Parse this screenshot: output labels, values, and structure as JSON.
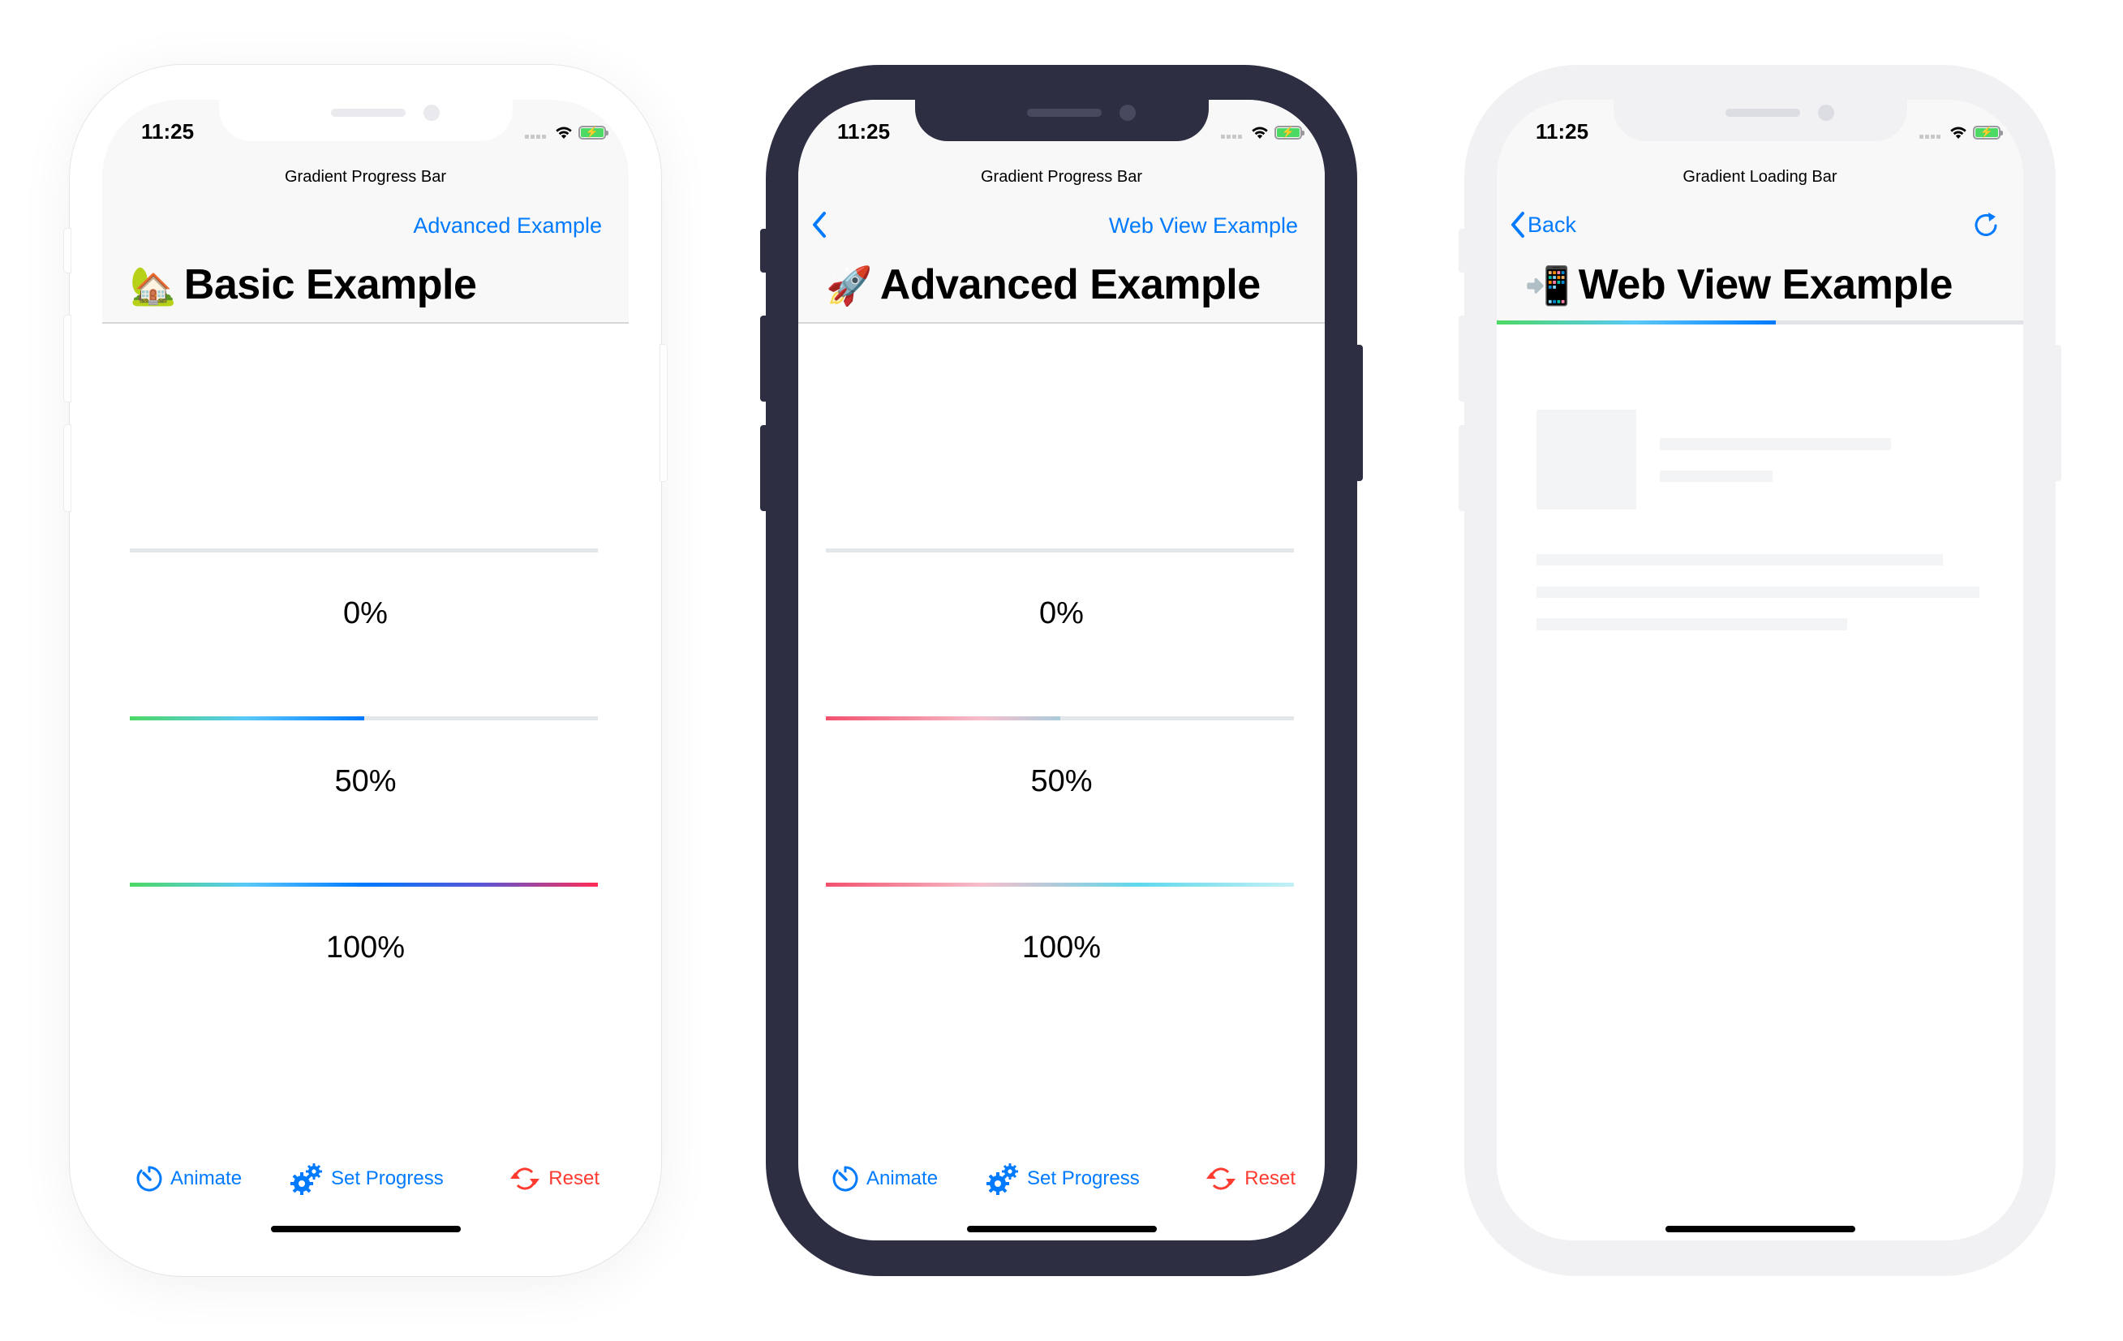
{
  "colors": {
    "tint": "#007aff",
    "destructive": "#ff3b30",
    "track": "#e4e7ea",
    "basic_gradient": [
      "#4cd964",
      "#5ac8fa",
      "#007aff",
      "#5856d6",
      "#ff2d55"
    ],
    "advanced_gradient": [
      "#f2516d",
      "#f7bfcc",
      "#5fd8ec",
      "#c3f1f6"
    ]
  },
  "phones": [
    {
      "frame": "white",
      "status": {
        "time": "11:25"
      },
      "nav": {
        "title": "Gradient Progress Bar",
        "right_link": "Advanced Example",
        "large_title": "Basic Example",
        "emoji": "🏡"
      },
      "bars": [
        {
          "progress": 0,
          "label": "0%"
        },
        {
          "progress": 0.5,
          "label": "50%"
        },
        {
          "progress": 1.0,
          "label": "100%"
        }
      ],
      "toolbar": {
        "animate": "Animate",
        "set_progress": "Set Progress",
        "reset": "Reset"
      }
    },
    {
      "frame": "dark",
      "status": {
        "time": "11:25"
      },
      "nav": {
        "title": "Gradient Progress Bar",
        "back_icon": "chevron-left",
        "right_link": "Web View Example",
        "large_title": "Advanced Example",
        "emoji": "🚀"
      },
      "bars": [
        {
          "progress": 0,
          "label": "0%"
        },
        {
          "progress": 0.5,
          "label": "50%"
        },
        {
          "progress": 1.0,
          "label": "100%"
        }
      ],
      "toolbar": {
        "animate": "Animate",
        "set_progress": "Set Progress",
        "reset": "Reset"
      }
    },
    {
      "frame": "light",
      "status": {
        "time": "11:25"
      },
      "nav": {
        "title": "Gradient Loading Bar",
        "back_label": "Back",
        "refresh_icon": "refresh",
        "large_title": "Web View Example",
        "emoji": "📲"
      },
      "loading_progress": 0.53
    }
  ]
}
